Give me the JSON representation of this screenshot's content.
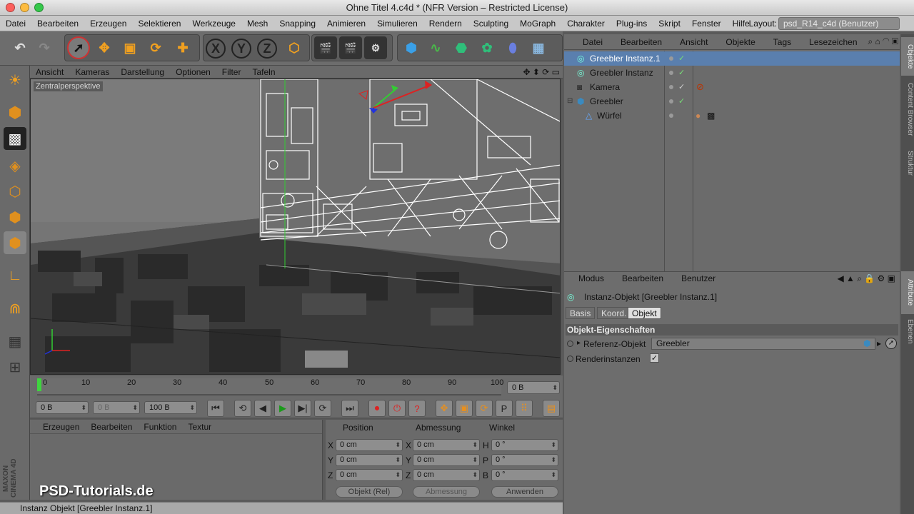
{
  "window": {
    "title": "Ohne Titel 4.c4d * (NFR Version – Restricted License)"
  },
  "menubar": {
    "items": [
      "Datei",
      "Bearbeiten",
      "Erzeugen",
      "Selektieren",
      "Werkzeuge",
      "Mesh",
      "Snapping",
      "Animieren",
      "Simulieren",
      "Rendern",
      "Sculpting",
      "MoGraph",
      "Charakter",
      "Plug-ins",
      "Skript",
      "Fenster",
      "Hilfe"
    ],
    "layout_label": "Layout:",
    "layout_value": "psd_R14_c4d (Benutzer)"
  },
  "toolbar": {
    "axis_x": "X",
    "axis_y": "Y",
    "axis_z": "Z"
  },
  "viewport": {
    "menu": [
      "Ansicht",
      "Kameras",
      "Darstellung",
      "Optionen",
      "Filter",
      "Tafeln"
    ],
    "camera_label": "Zentralperspektive"
  },
  "timeline": {
    "ticks": [
      "0",
      "10",
      "20",
      "30",
      "40",
      "50",
      "60",
      "70",
      "80",
      "90",
      "100"
    ],
    "current_frame": "0 B",
    "start": "0 B",
    "preview_start": "0 B",
    "end": "100 B"
  },
  "materials": {
    "menu": [
      "Erzeugen",
      "Bearbeiten",
      "Funktion",
      "Textur"
    ]
  },
  "coords": {
    "headers": [
      "Position",
      "Abmessung",
      "Winkel"
    ],
    "rows": [
      {
        "axis": "X",
        "pos": "0 cm",
        "size_axis": "X",
        "size": "0 cm",
        "rot_axis": "H",
        "rot": "0 °"
      },
      {
        "axis": "Y",
        "pos": "0 cm",
        "size_axis": "Y",
        "size": "0 cm",
        "rot_axis": "P",
        "rot": "0 °"
      },
      {
        "axis": "Z",
        "pos": "0 cm",
        "size_axis": "Z",
        "size": "0 cm",
        "rot_axis": "B",
        "rot": "0 °"
      }
    ],
    "mode_select": "Objekt (Rel)",
    "size_select": "Abmessung",
    "apply": "Anwenden"
  },
  "objects": {
    "menu": [
      "Datei",
      "Bearbeiten",
      "Ansicht",
      "Objekte",
      "Tags",
      "Lesezeichen"
    ],
    "rows": [
      {
        "name": "Greebler Instanz.1",
        "selected": true
      },
      {
        "name": "Greebler Instanz",
        "selected": false
      },
      {
        "name": "Kamera",
        "selected": false
      },
      {
        "name": "Greebler",
        "selected": false
      },
      {
        "name": "Würfel",
        "selected": false
      }
    ]
  },
  "attributes": {
    "menu": [
      "Modus",
      "Bearbeiten",
      "Benutzer"
    ],
    "object_title": "Instanz-Objekt [Greebler Instanz.1]",
    "tabs": [
      "Basis",
      "Koord.",
      "Objekt"
    ],
    "active_tab": "Objekt",
    "section": "Objekt-Eigenschaften",
    "ref_label": "Referenz-Objekt",
    "ref_value": "Greebler",
    "render_label": "Renderinstanzen"
  },
  "side_tabs": [
    "Objekte",
    "Content Browser",
    "Struktur",
    "Attribute",
    "Ebenen"
  ],
  "status": {
    "text": "Instanz Objekt [Greebler Instanz.1]"
  },
  "watermark": "PSD-Tutorials.de",
  "brand": "MAXON CINEMA 4D",
  "colors": {
    "accent_orange": "#e89a1e",
    "selection_blue": "#5a7fae",
    "timeline_green": "#3fd43f"
  }
}
